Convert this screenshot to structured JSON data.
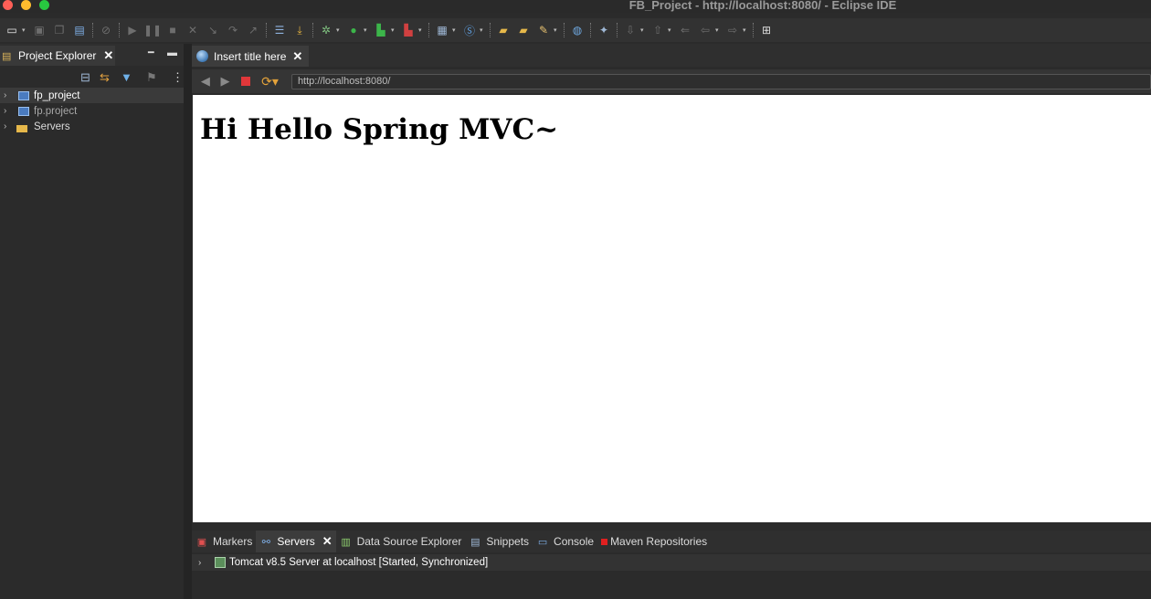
{
  "window": {
    "title": "FB_Project - http://localhost:8080/ - Eclipse IDE"
  },
  "toolbar": {
    "icons": [
      "new-icon",
      "save-icon",
      "save-all-icon",
      "open-console-icon",
      "skip-breakpoints-icon",
      "resume-icon",
      "suspend-icon",
      "terminate-icon",
      "disconnect-icon",
      "step-into-icon",
      "step-over-icon",
      "step-return-icon",
      "use-step-filters-icon",
      "drop-to-frame-icon",
      "debug-icon",
      "run-icon",
      "coverage-icon",
      "external-tools-icon",
      "new-server-icon",
      "open-type-icon",
      "open-task-icon",
      "search-icon",
      "open-web-browser-icon",
      "next-annotation-icon",
      "previous-annotation-icon",
      "last-edit-location-icon",
      "back-icon",
      "forward-icon",
      "open-perspective-icon"
    ]
  },
  "project_explorer": {
    "tab_label": "Project Explorer",
    "items": [
      {
        "label": "fp_project",
        "selected": true
      },
      {
        "label": "fp.project",
        "selected": false
      },
      {
        "label": "Servers",
        "selected": false
      }
    ]
  },
  "editor": {
    "tab_label": "Insert title here",
    "url": "http://localhost:8080/",
    "page_heading": "Hi Hello Spring MVC~"
  },
  "bottom_panel": {
    "tabs": {
      "markers": "Markers",
      "servers": "Servers",
      "data_source_explorer": "Data Source Explorer",
      "snippets": "Snippets",
      "console": "Console",
      "maven_repositories": "Maven Repositories"
    },
    "server_entry": "Tomcat v8.5 Server at localhost  [Started, Synchronized]"
  },
  "colors": {
    "accent_stop": "#e0373a",
    "traffic_red": "#ff5f57",
    "traffic_yellow": "#febc2e",
    "traffic_green": "#28c840"
  }
}
